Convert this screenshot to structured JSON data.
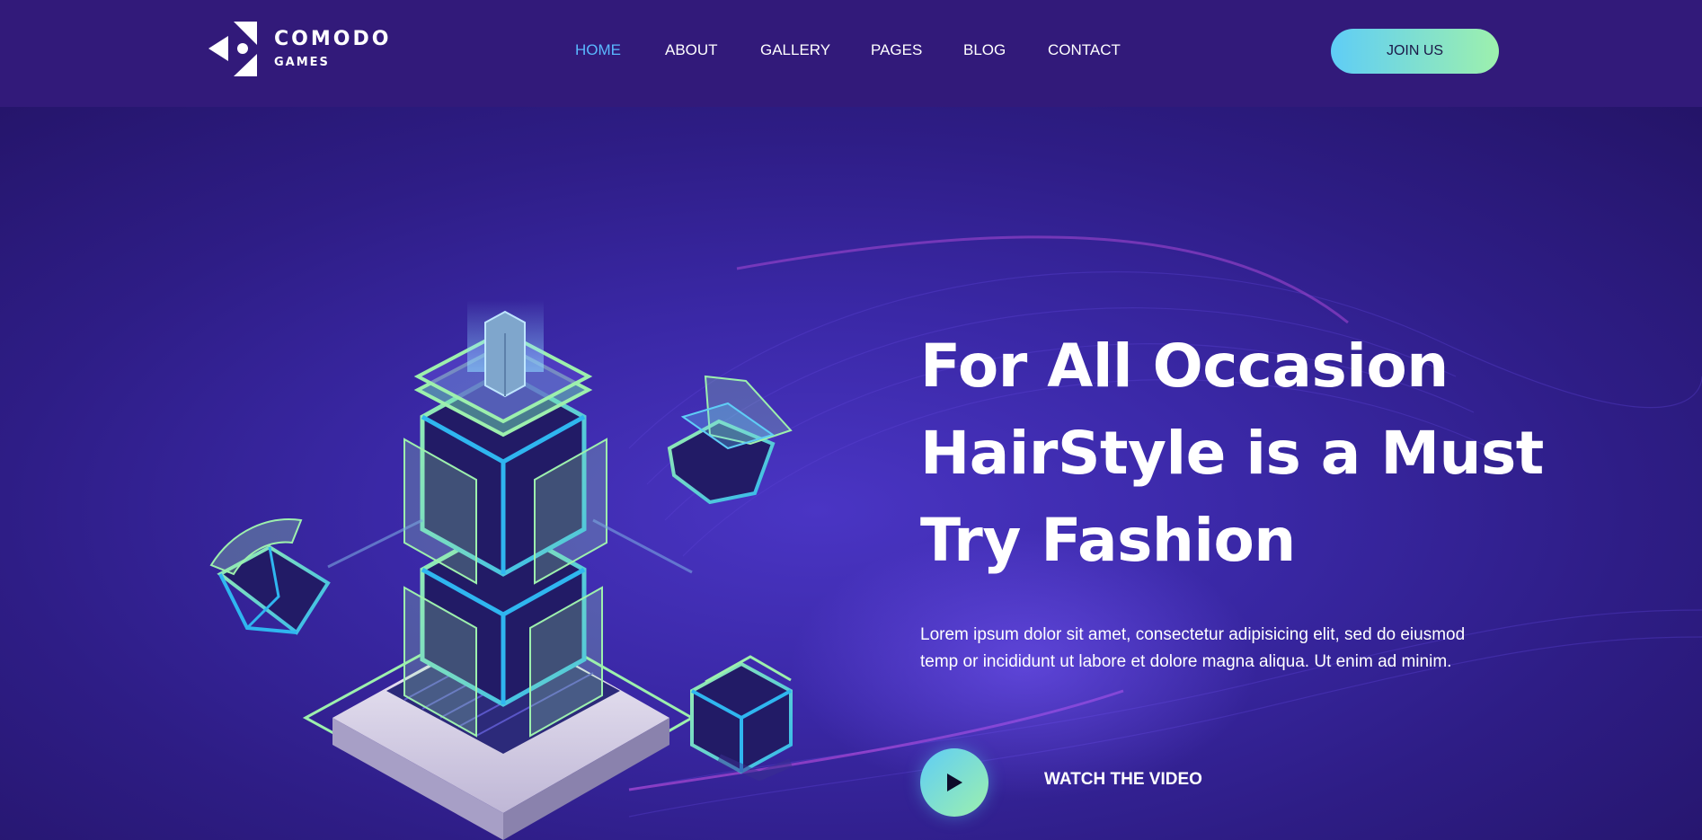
{
  "brand": {
    "title": "COMODO",
    "subtitle": "GAMES"
  },
  "nav": {
    "items": [
      {
        "label": "HOME",
        "active": true
      },
      {
        "label": "ABOUT"
      },
      {
        "label": "GALLERY"
      },
      {
        "label": "PAGES"
      },
      {
        "label": "BLOG"
      },
      {
        "label": "CONTACT"
      }
    ]
  },
  "header": {
    "join_label": "JOIN US"
  },
  "hero": {
    "headline_lines": [
      "For All Occasion",
      "HairStyle is a Must",
      "Try Fashion"
    ],
    "lead": "Lorem ipsum dolor sit amet, consectetur adipisicing elit, sed do eiusmod temp or incididunt ut labore et dolore magna aliqua. Ut enim ad minim.",
    "watch_label": "WATCH THE VIDEO"
  },
  "icons": {
    "logo": "comodo-logo-icon",
    "play": "play-icon"
  },
  "colors": {
    "header_bg": "#321a7a",
    "hero_bg": "#3a28a6",
    "nav_active": "#5ab8ff",
    "accent_start": "#5fcdf6",
    "accent_end": "#9df0ad"
  }
}
